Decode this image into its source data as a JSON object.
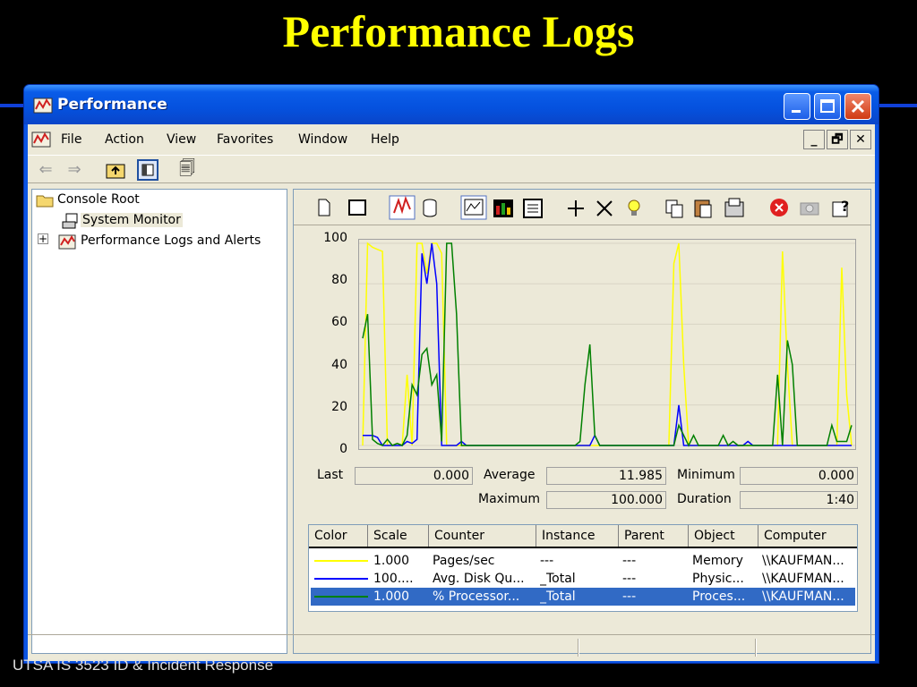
{
  "slide": {
    "title": "Performance Logs",
    "footer": "UTSA IS 3523 ID & Incident Response"
  },
  "window": {
    "title": "Performance",
    "controls": [
      "minimize",
      "maximize",
      "close"
    ]
  },
  "menu": {
    "items": [
      "File",
      "Action",
      "View",
      "Favorites",
      "Window",
      "Help"
    ],
    "mdi_buttons": [
      "_",
      "🗗",
      "✕"
    ]
  },
  "tree": {
    "items": [
      {
        "label": "Console Root",
        "icon": "folder-icon"
      },
      {
        "label": "System Monitor",
        "icon": "system-monitor-icon",
        "selected": true
      },
      {
        "label": "Performance Logs and Alerts",
        "icon": "perf-logs-icon",
        "expander": "+"
      }
    ]
  },
  "monitor": {
    "toolbar_icons": [
      "new-counter-set-icon",
      "clear-display-icon",
      "view-current-activity-icon",
      "view-log-data-icon",
      "view-graph-icon",
      "view-histogram-icon",
      "view-report-icon",
      "add-icon",
      "delete-icon",
      "highlight-icon",
      "copy-properties-icon",
      "paste-counter-list-icon",
      "properties-icon",
      "freeze-display-icon",
      "update-data-icon",
      "help-icon"
    ],
    "stats": {
      "last_label": "Last",
      "last": "0.000",
      "average_label": "Average",
      "average": "11.985",
      "minimum_label": "Minimum",
      "minimum": "0.000",
      "maximum_label": "Maximum",
      "maximum": "100.000",
      "duration_label": "Duration",
      "duration": "1:40"
    },
    "columns": [
      "Color",
      "Scale",
      "Counter",
      "Instance",
      "Parent",
      "Object",
      "Computer"
    ],
    "rows": [
      {
        "color": "#ffff00",
        "scale": "1.000",
        "counter": "Pages/sec",
        "instance": "---",
        "parent": "---",
        "object": "Memory",
        "computer": "\\\\KAUFMAN..."
      },
      {
        "color": "#0000ff",
        "scale": "100....",
        "counter": "Avg. Disk Qu...",
        "instance": "_Total",
        "parent": "---",
        "object": "Physic...",
        "computer": "\\\\KAUFMAN..."
      },
      {
        "color": "#008000",
        "scale": "1.000",
        "counter": "% Processor...",
        "instance": "_Total",
        "parent": "---",
        "object": "Proces...",
        "computer": "\\\\KAUFMAN...",
        "selected": true
      }
    ]
  },
  "chart_data": {
    "type": "line",
    "ylim": [
      0,
      100
    ],
    "yticks": [
      0,
      20,
      40,
      60,
      80,
      100
    ],
    "grid": true,
    "x": [
      0,
      1,
      2,
      3,
      4,
      5,
      6,
      7,
      8,
      9,
      10,
      11,
      12,
      13,
      14,
      15,
      16,
      17,
      18,
      19,
      20,
      21,
      22,
      23,
      24,
      25,
      26,
      27,
      28,
      29,
      30,
      31,
      32,
      33,
      34,
      35,
      36,
      37,
      38,
      39,
      40,
      41,
      42,
      43,
      44,
      45,
      46,
      47,
      48,
      49,
      50,
      51,
      52,
      53,
      54,
      55,
      56,
      57,
      58,
      59,
      60,
      61,
      62,
      63,
      64,
      65,
      66,
      67,
      68,
      69,
      70,
      71,
      72,
      73,
      74,
      75,
      76,
      77,
      78,
      79,
      80,
      81,
      82,
      83,
      84,
      85,
      86,
      87,
      88,
      89,
      90,
      91,
      92,
      93,
      94,
      95,
      96,
      97,
      98,
      99
    ],
    "series": [
      {
        "color": "#ffff00",
        "values": [
          0,
          100,
          98,
          97,
          96,
          0,
          0,
          1,
          0,
          35,
          0,
          100,
          100,
          85,
          100,
          100,
          95,
          0,
          0,
          0,
          0,
          0,
          0,
          0,
          0,
          0,
          0,
          0,
          0,
          0,
          0,
          0,
          0,
          0,
          0,
          0,
          0,
          0,
          0,
          0,
          0,
          0,
          0,
          0,
          0,
          0,
          0,
          0,
          0,
          0,
          0,
          0,
          0,
          0,
          0,
          0,
          0,
          0,
          0,
          0,
          0,
          0,
          0,
          90,
          100,
          40,
          0,
          0,
          0,
          0,
          0,
          0,
          0,
          0,
          0,
          0,
          0,
          0,
          0,
          0,
          0,
          0,
          0,
          0,
          0,
          96,
          40,
          0,
          0,
          0,
          0,
          0,
          0,
          0,
          0,
          0,
          0,
          88,
          25,
          0
        ]
      },
      {
        "color": "#0000ff",
        "values": [
          5,
          5,
          5,
          4,
          0,
          0,
          0,
          0,
          0,
          2,
          1,
          3,
          95,
          80,
          100,
          80,
          0,
          0,
          0,
          0,
          2,
          0,
          0,
          0,
          0,
          0,
          0,
          0,
          0,
          0,
          0,
          0,
          0,
          0,
          0,
          0,
          0,
          0,
          0,
          0,
          0,
          0,
          0,
          0,
          0,
          0,
          0,
          5,
          0,
          0,
          0,
          0,
          0,
          0,
          0,
          0,
          0,
          0,
          0,
          0,
          0,
          0,
          0,
          0,
          20,
          0,
          0,
          0,
          0,
          0,
          0,
          0,
          0,
          0,
          0,
          0,
          0,
          0,
          2,
          0,
          0,
          0,
          0,
          0,
          0,
          0,
          0,
          0,
          0,
          0,
          0,
          0,
          0,
          0,
          0,
          0,
          0,
          0,
          0,
          0
        ]
      },
      {
        "color": "#008000",
        "values": [
          53,
          65,
          3,
          1,
          0,
          3,
          0,
          1,
          0,
          5,
          30,
          25,
          45,
          48,
          30,
          35,
          2,
          100,
          100,
          65,
          0,
          0,
          0,
          0,
          0,
          0,
          0,
          0,
          0,
          0,
          0,
          0,
          0,
          0,
          0,
          0,
          0,
          0,
          0,
          0,
          0,
          0,
          0,
          0,
          2,
          30,
          50,
          5,
          0,
          0,
          0,
          0,
          0,
          0,
          0,
          0,
          0,
          0,
          0,
          0,
          0,
          0,
          0,
          0,
          10,
          5,
          0,
          5,
          0,
          0,
          0,
          0,
          0,
          5,
          0,
          2,
          0,
          0,
          0,
          0,
          0,
          0,
          0,
          0,
          35,
          0,
          52,
          40,
          0,
          0,
          0,
          0,
          0,
          0,
          0,
          10,
          2,
          2,
          2,
          10
        ]
      }
    ]
  }
}
